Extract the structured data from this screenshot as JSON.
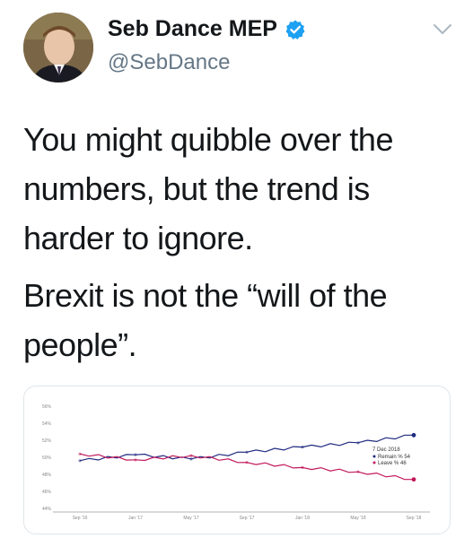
{
  "tweet": {
    "display_name": "Seb Dance MEP",
    "handle": "@SebDance",
    "verified": true,
    "paragraphs": [
      "You might quibble over the numbers, but the trend is harder to ignore.",
      "Brexit is not the “will of the people”."
    ]
  },
  "icons": {
    "verified": "verified-badge-icon",
    "menu": "chevron-down-icon"
  },
  "colors": {
    "verified_blue": "#1da1f2",
    "remain": "#1f2a80",
    "leave": "#c2185b"
  },
  "chart_data": {
    "type": "line",
    "x": [
      "Sep '16",
      "Jan '17",
      "May '17",
      "Sep '17",
      "Jan '18",
      "May '18",
      "Sep '18"
    ],
    "y_ticks": [
      "56%",
      "54%",
      "52%",
      "50%",
      "48%",
      "46%",
      "44%"
    ],
    "ylim": [
      44,
      56
    ],
    "legend_date": "7 Dec 2018",
    "series": [
      {
        "name": "Remain %",
        "latest": "54",
        "values": [
          49.6,
          50.3,
          49.8,
          50.6,
          51.2,
          51.7,
          52.6
        ]
      },
      {
        "name": "Leave %",
        "latest": "46",
        "values": [
          50.4,
          49.7,
          50.2,
          49.4,
          48.8,
          48.3,
          47.4
        ]
      }
    ]
  }
}
